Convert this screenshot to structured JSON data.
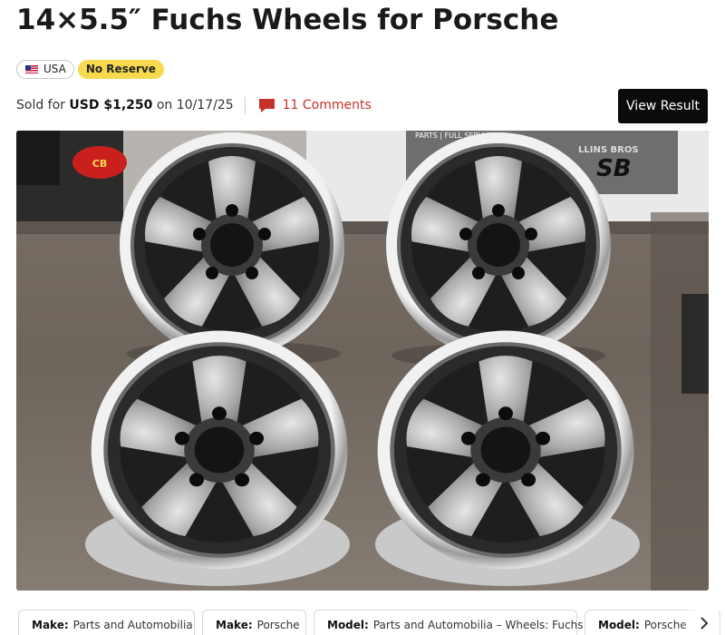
{
  "listing": {
    "title": "14×5.5″ Fuchs Wheels for Porsche",
    "badges": {
      "country": "USA",
      "no_reserve": "No Reserve"
    },
    "sold": {
      "prefix": "Sold for",
      "price": "USD $1,250",
      "on": "on",
      "date": "10/17/25"
    },
    "comments": "11 Comments",
    "view_result": "View Result"
  },
  "photo": {
    "signs": {
      "cb_logo": "CB",
      "banner_text": "PARTS | FULL SERVICE",
      "collins_text": "LLINS BROS",
      "sb_text": "SB"
    }
  },
  "tags": [
    {
      "key": "Make:",
      "value": "Parts and Automobilia"
    },
    {
      "key": "Make:",
      "value": "Porsche"
    },
    {
      "key": "Model:",
      "value": "Parts and Automobilia – Wheels: Fuchs"
    },
    {
      "key": "Model:",
      "value": "Porsche"
    }
  ],
  "tags_next_icon": "chevron-right-icon",
  "colors": {
    "accent_red": "#c8302a",
    "badge_yellow": "#f6d94f",
    "button_black": "#0b0b0b"
  }
}
